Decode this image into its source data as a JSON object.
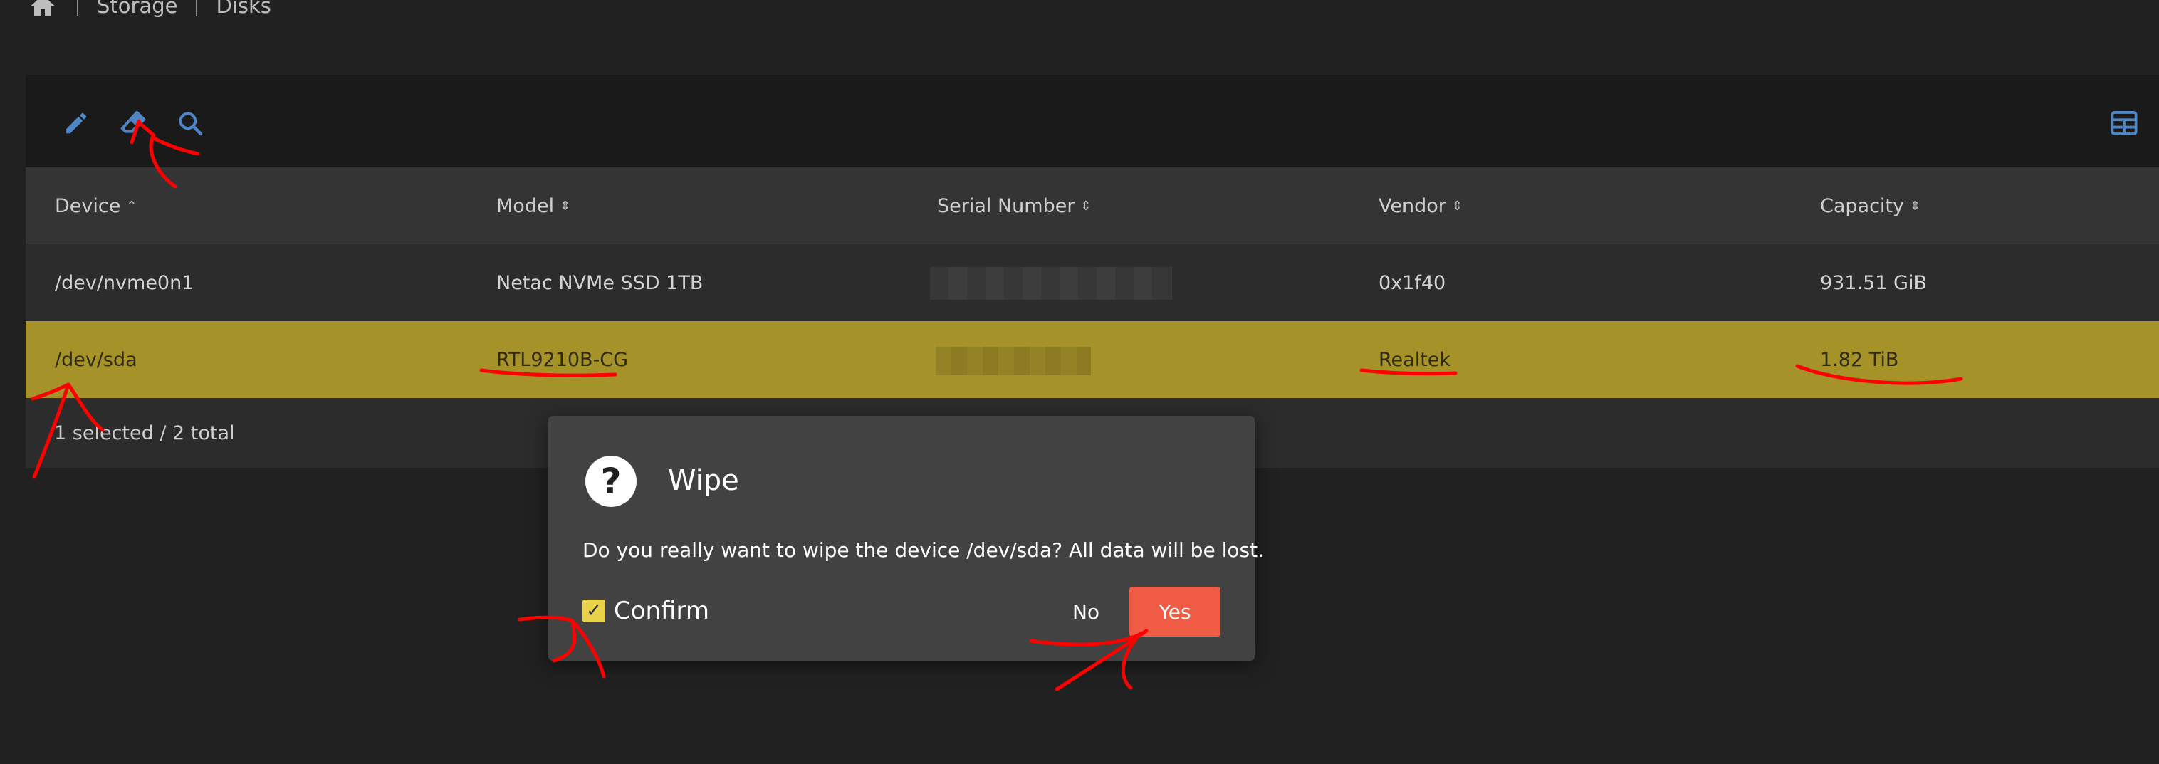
{
  "breadcrumb": {
    "items": [
      "Storage",
      "Disks"
    ],
    "home_icon": "home-icon"
  },
  "toolbar": {
    "icons": [
      "pencil-icon",
      "eraser-icon",
      "search-icon"
    ],
    "right_icon": "table-columns-icon",
    "accent_color": "#4f86c6"
  },
  "table": {
    "columns": [
      {
        "label": "Device",
        "sort": "⌃"
      },
      {
        "label": "Model",
        "sort": "⇕"
      },
      {
        "label": "Serial Number",
        "sort": "⇕"
      },
      {
        "label": "Vendor",
        "sort": "⇕"
      },
      {
        "label": "Capacity",
        "sort": "⇕"
      }
    ],
    "rows": [
      {
        "device": "/dev/nvme0n1",
        "model": "Netac NVMe SSD 1TB",
        "vendor": "0x1f40",
        "capacity": "931.51 GiB",
        "selected": false
      },
      {
        "device": "/dev/sda",
        "model": "RTL9210B-CG",
        "vendor": "Realtek",
        "capacity": "1.82 TiB",
        "selected": true
      }
    ],
    "selected_color": "#a59228",
    "footer": "1 selected / 2 total"
  },
  "dialog": {
    "icon": "question-icon",
    "icon_glyph": "?",
    "title": "Wipe",
    "message": "Do you really want to wipe the device /dev/sda? All data will be lost.",
    "confirm_label": "Confirm",
    "confirm_checked": true,
    "check_glyph": "✓",
    "no_label": "No",
    "yes_label": "Yes",
    "yes_color": "#ef5b45"
  },
  "annotation_color": "#ff0000"
}
